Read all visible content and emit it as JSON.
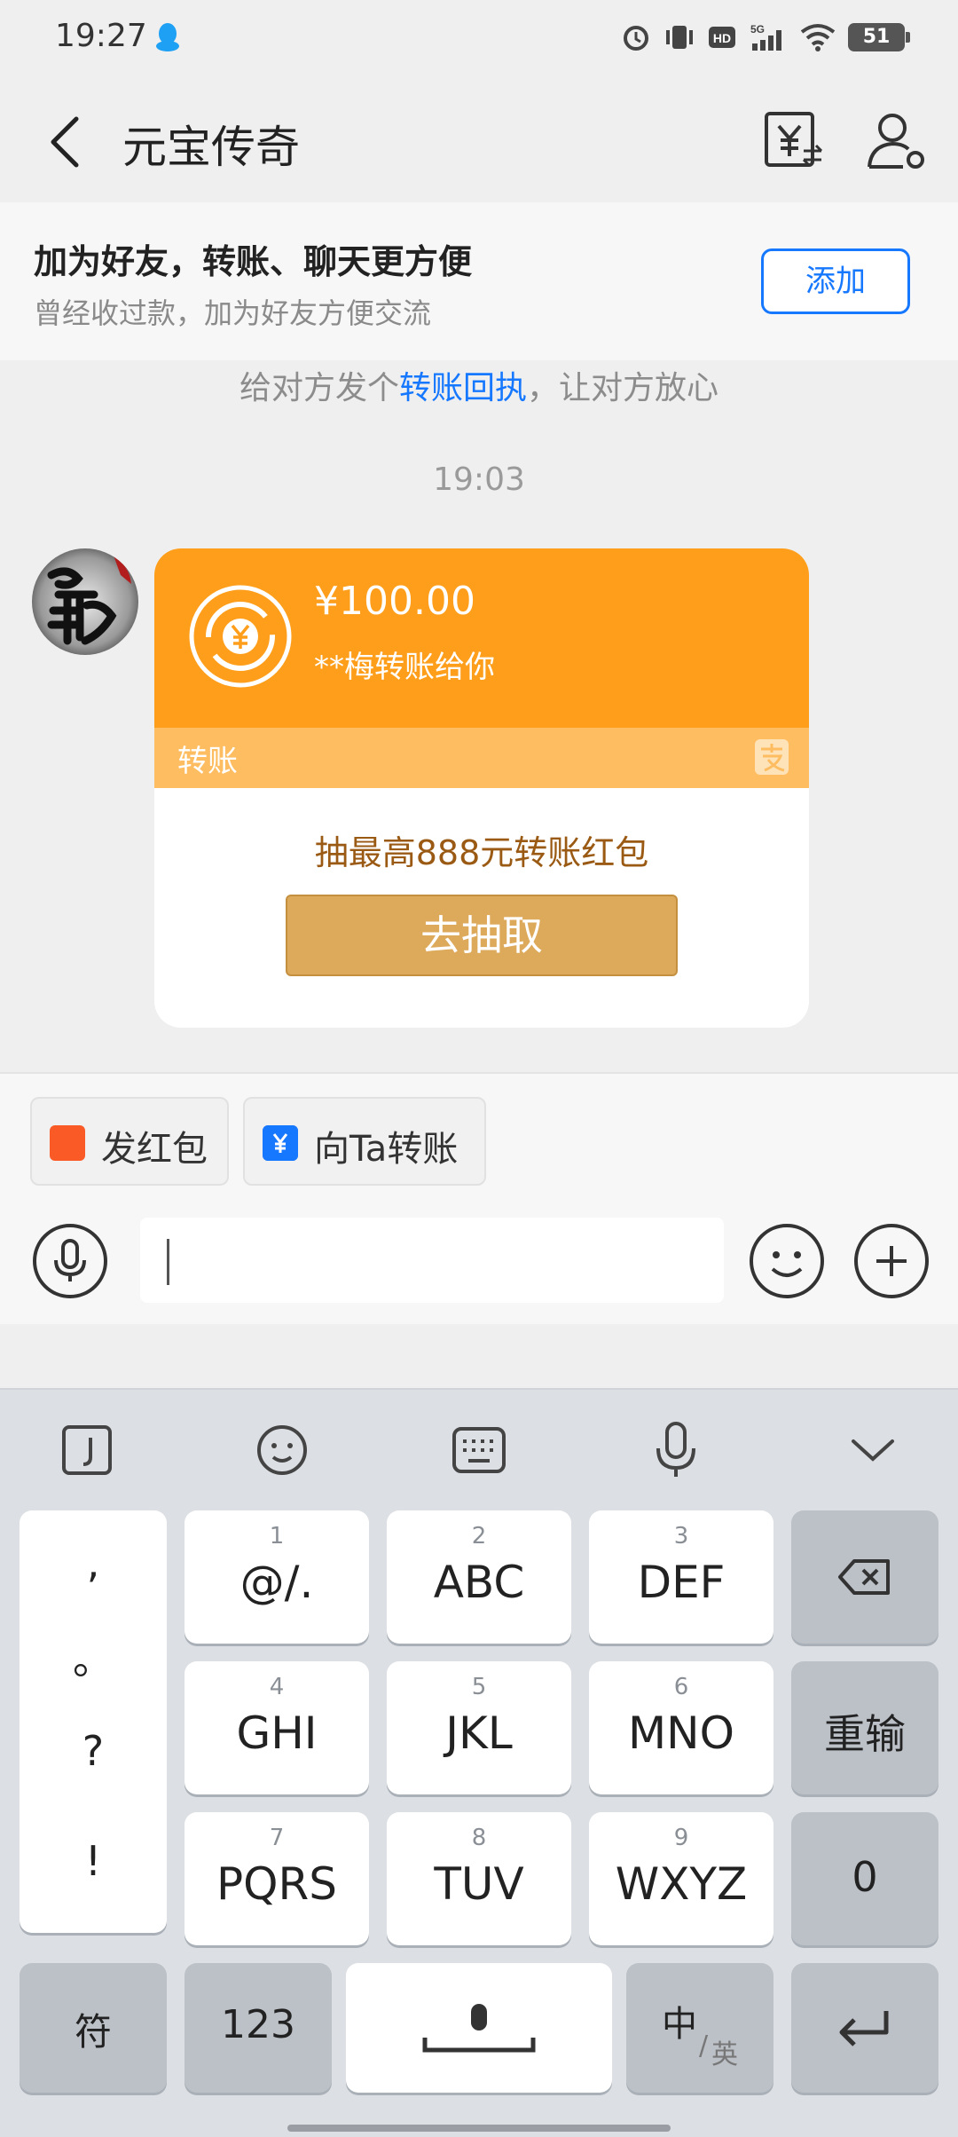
{
  "status_bar": {
    "time": "19:27",
    "battery": "51"
  },
  "nav": {
    "title": "元宝传奇"
  },
  "banner": {
    "title": "加为好友，转账、聊天更方便",
    "subtitle": "曾经收过款，加为好友方便交流",
    "add_label": "添加"
  },
  "chat": {
    "tip_prefix": "给对方发个",
    "tip_link": "转账回执",
    "tip_suffix": "，让对方放心",
    "time": "19:03",
    "transfer_card": {
      "amount": "¥100.00",
      "description": "**梅转账给你",
      "type_label": "转账",
      "promo": "抽最高888元转账红包",
      "button_label": "去抽取"
    }
  },
  "quick_actions": {
    "red_packet": "发红包",
    "transfer_to": "向Ta转账"
  },
  "input": {
    "value": ""
  },
  "keyboard": {
    "punctuation": [
      ",",
      "。",
      "?",
      "!"
    ],
    "keys": [
      {
        "num": "1",
        "letters": "@/."
      },
      {
        "num": "2",
        "letters": "ABC"
      },
      {
        "num": "3",
        "letters": "DEF"
      },
      {
        "num": "4",
        "letters": "GHI"
      },
      {
        "num": "5",
        "letters": "JKL"
      },
      {
        "num": "6",
        "letters": "MNO"
      },
      {
        "num": "7",
        "letters": "PQRS"
      },
      {
        "num": "8",
        "letters": "TUV"
      },
      {
        "num": "9",
        "letters": "WXYZ"
      }
    ],
    "reinput": "重输",
    "zero": "0",
    "symbols": "符",
    "numbers": "123",
    "lang_cn": "中",
    "lang_en": "英"
  },
  "colors": {
    "accent": "#1677ff",
    "card_orange": "#ff9e1b",
    "card_band": "#ffbd62",
    "promo_button": "#ddaa5c"
  }
}
